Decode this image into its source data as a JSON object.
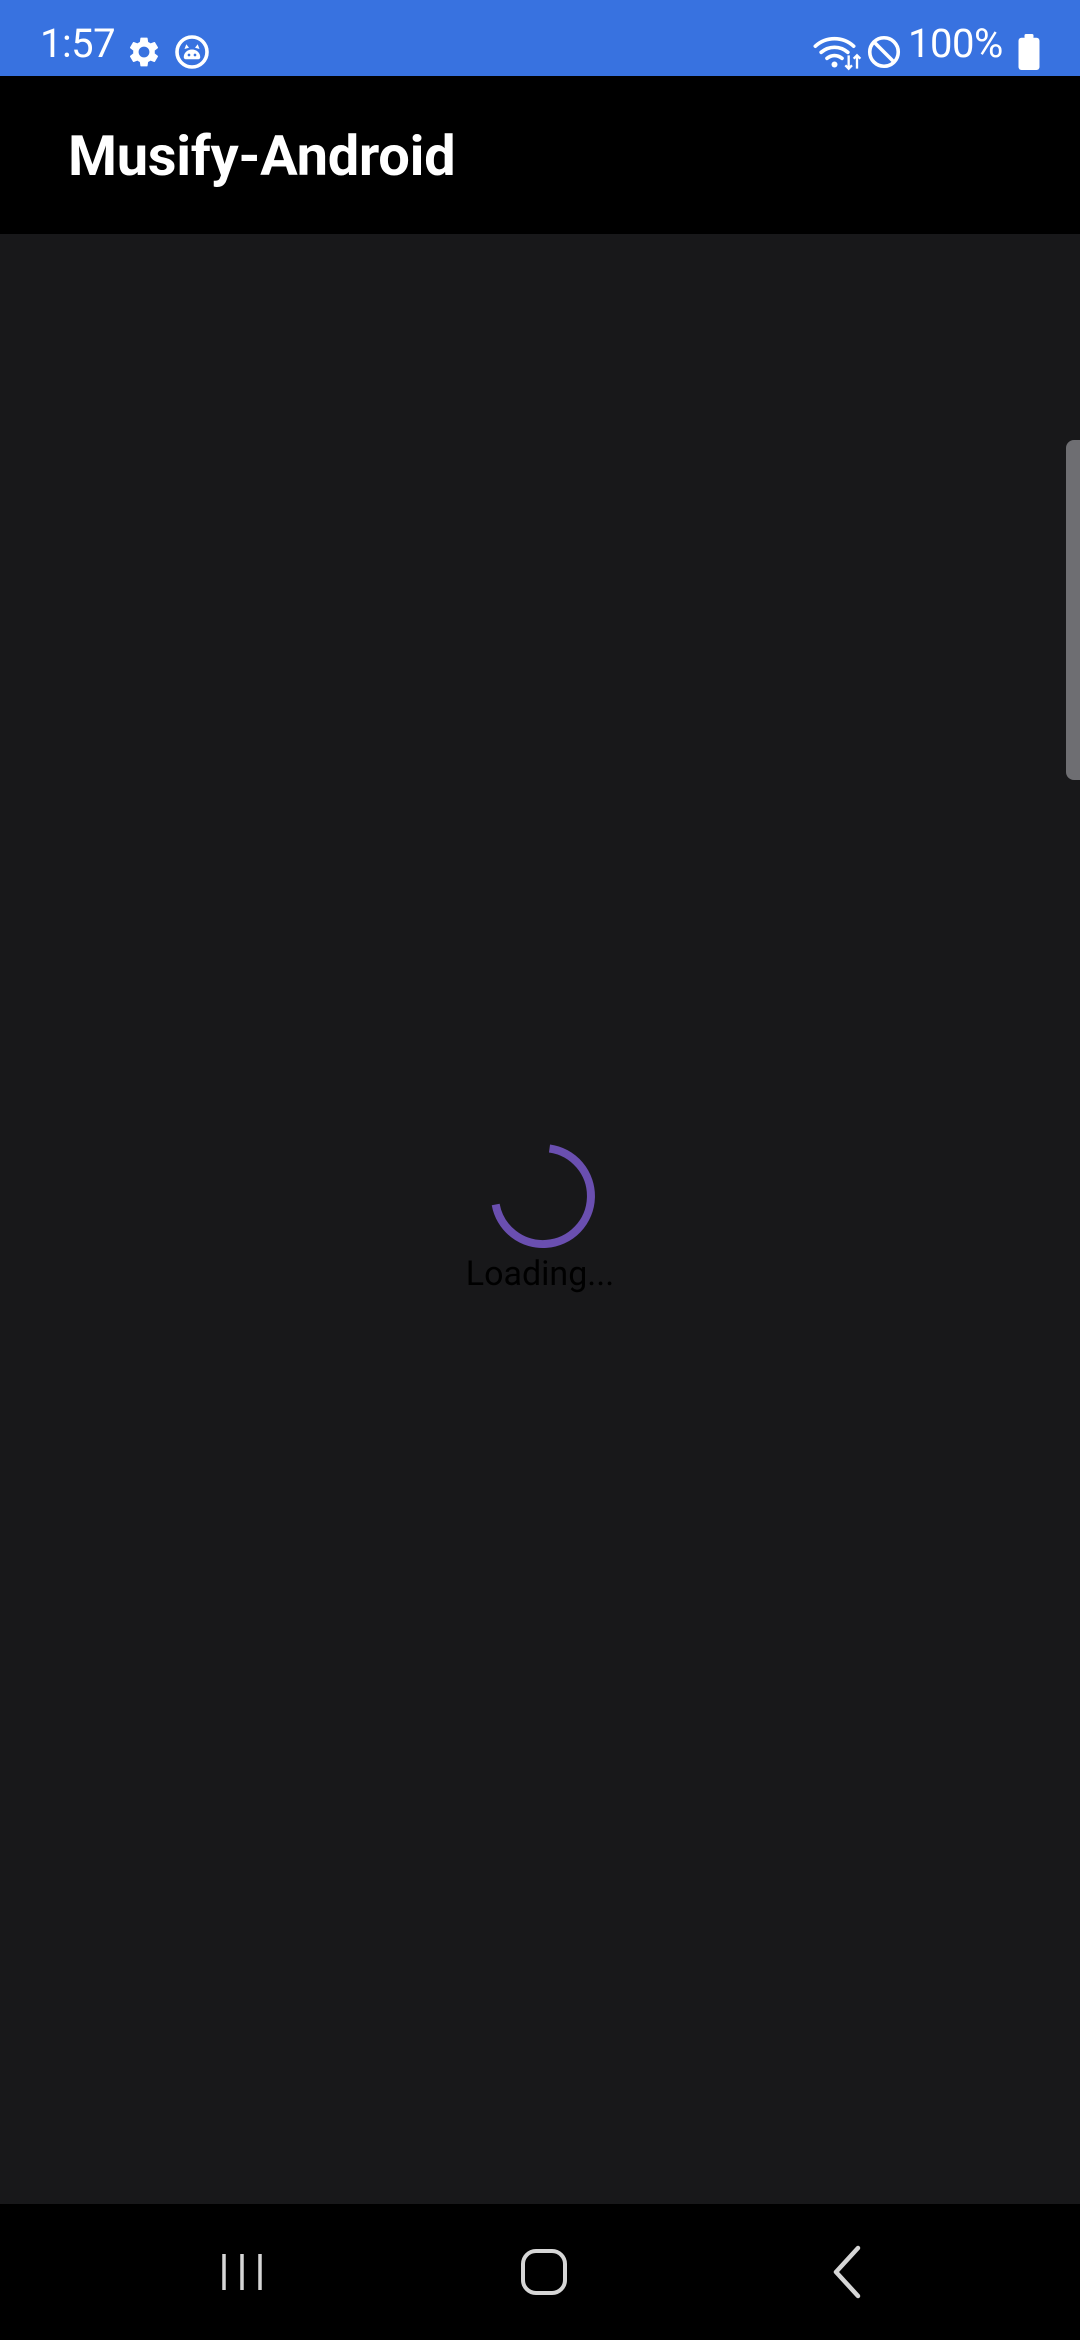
{
  "status_bar": {
    "time": "1:57",
    "battery": "100%",
    "background_color": "#3872e0",
    "icons": [
      "gear-icon",
      "cat-face-icon",
      "wifi-icon",
      "do-not-disturb-icon",
      "battery-icon"
    ]
  },
  "app_bar": {
    "title": "Musify-Android"
  },
  "content": {
    "loading_text": "Loading...",
    "spinner_color": "#6a4fb0",
    "background_color": "#18181a"
  },
  "nav_bar": {
    "buttons": [
      "recents-icon",
      "home-icon",
      "back-icon"
    ]
  }
}
